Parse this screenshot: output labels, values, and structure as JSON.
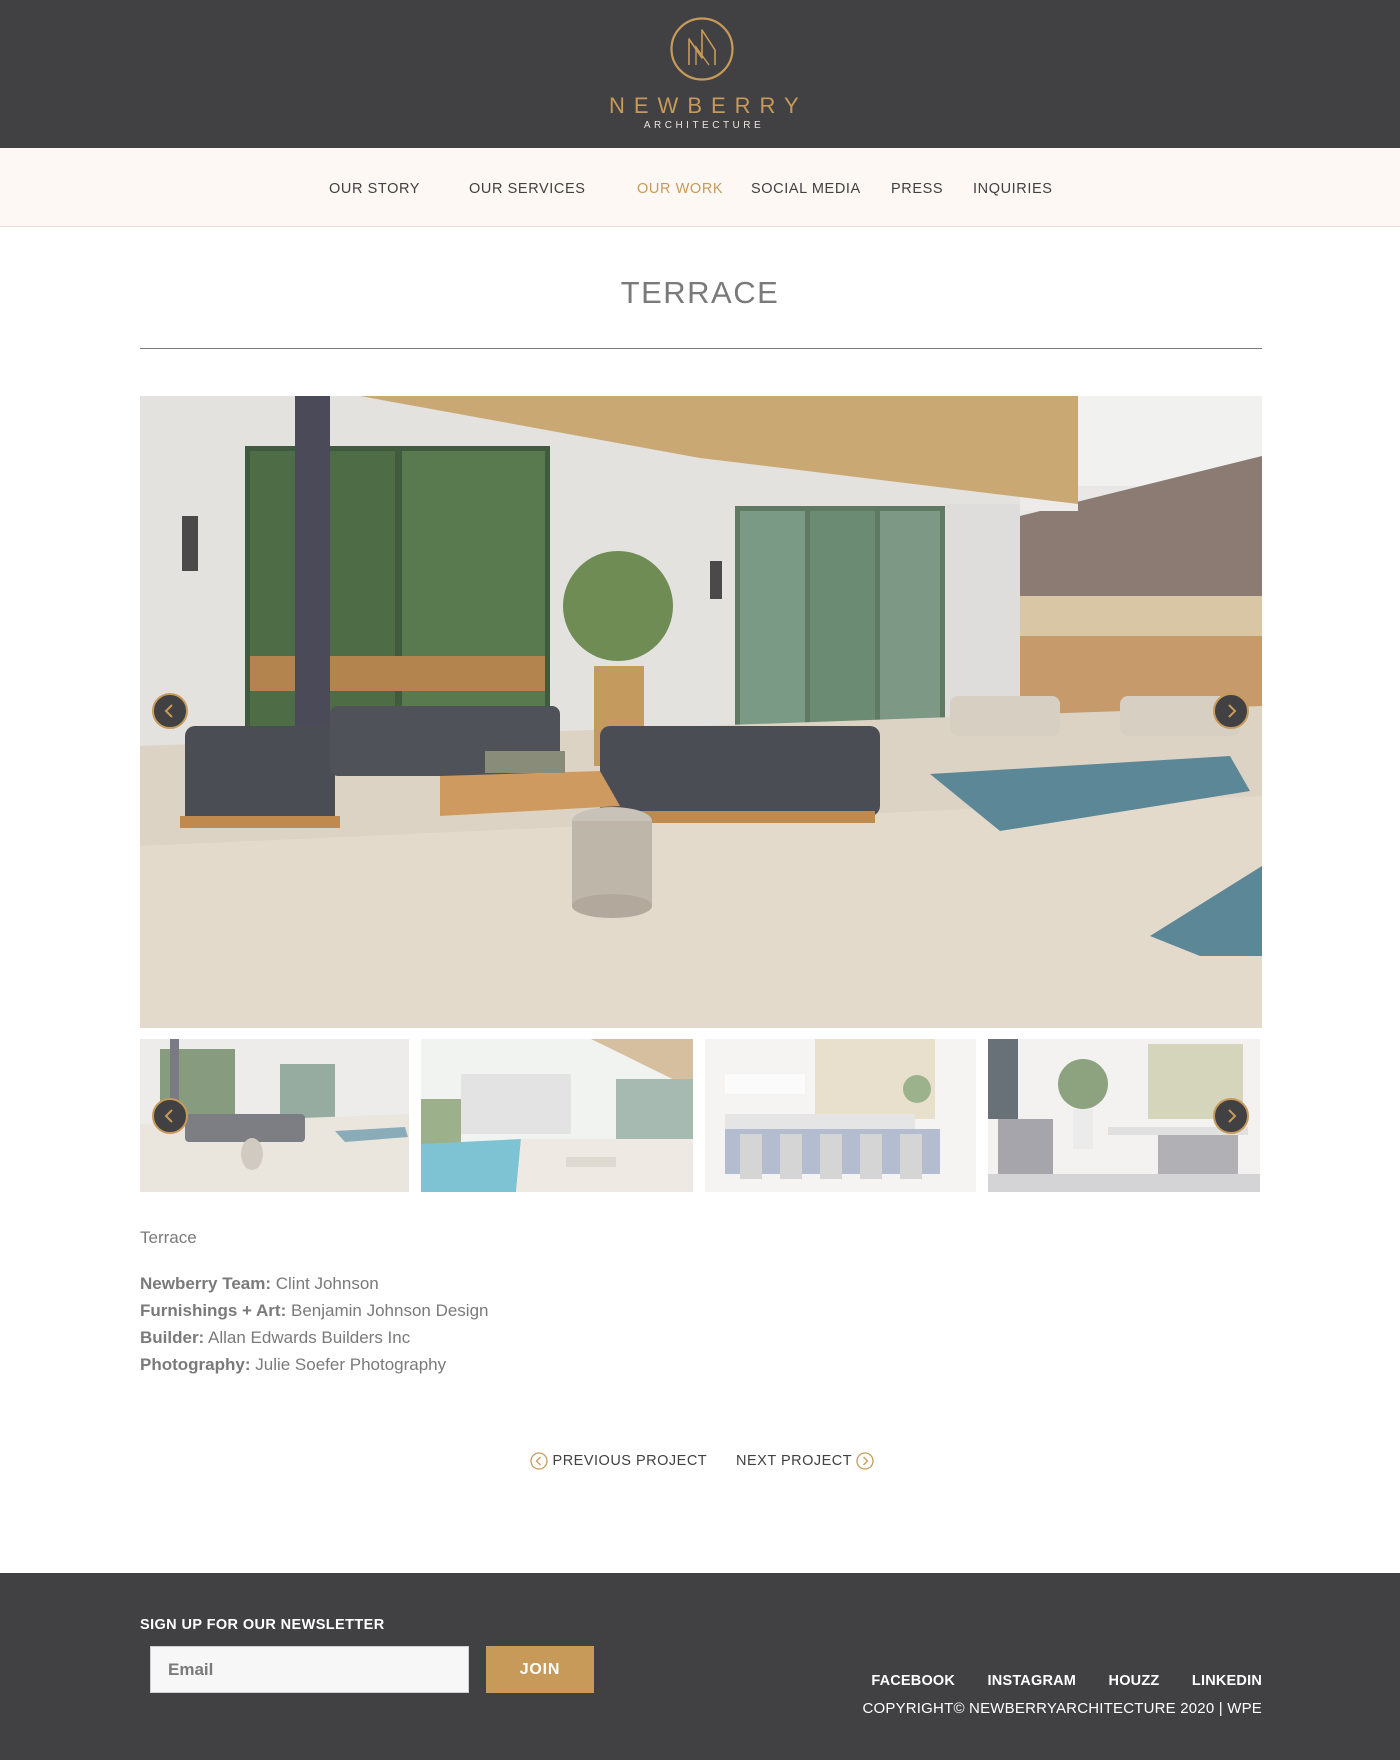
{
  "header": {
    "brand": "NEWBERRY",
    "tagline": "ARCHITECTURE"
  },
  "nav": {
    "items": [
      {
        "label": "OUR STORY",
        "active": false
      },
      {
        "label": "OUR SERVICES",
        "active": false
      },
      {
        "label": "OUR WORK",
        "active": true
      },
      {
        "label": "SOCIAL MEDIA",
        "active": false
      },
      {
        "label": "PRESS",
        "active": false
      },
      {
        "label": "INQUIRIES",
        "active": false
      }
    ]
  },
  "page": {
    "title": "TERRACE"
  },
  "gallery": {
    "main_image": "terrace-outdoor-living-photo",
    "thumbnails": [
      "terrace-seating-thumb",
      "pool-courtyard-thumb",
      "kitchen-island-thumb",
      "dining-room-thumb"
    ],
    "prev_icon": "chevron-left-icon",
    "next_icon": "chevron-right-icon"
  },
  "project": {
    "caption": "Terrace",
    "credits": [
      {
        "label": "Newberry Team:",
        "value": "Clint Johnson"
      },
      {
        "label": "Furnishings + Art:",
        "value": "Benjamin Johnson Design"
      },
      {
        "label": "Builder:",
        "value": "Allan Edwards Builders Inc"
      },
      {
        "label": "Photography:",
        "value": "Julie Soefer Photography"
      }
    ]
  },
  "project_nav": {
    "previous": "PREVIOUS PROJECT",
    "next": "NEXT PROJECT"
  },
  "footer": {
    "newsletter_title": "SIGN UP FOR OUR NEWSLETTER",
    "email_placeholder": "Email",
    "join_label": "JOIN",
    "social": [
      "FACEBOOK",
      "INSTAGRAM",
      "HOUZZ",
      "LINKEDIN"
    ],
    "copyright": "COPYRIGHT© NEWBERRYARCHITECTURE 2020 | WPE"
  },
  "colors": {
    "dark": "#414042",
    "gold": "#c79a5a",
    "cream": "#fdf8f3",
    "text_gray": "#7a7a7a"
  }
}
